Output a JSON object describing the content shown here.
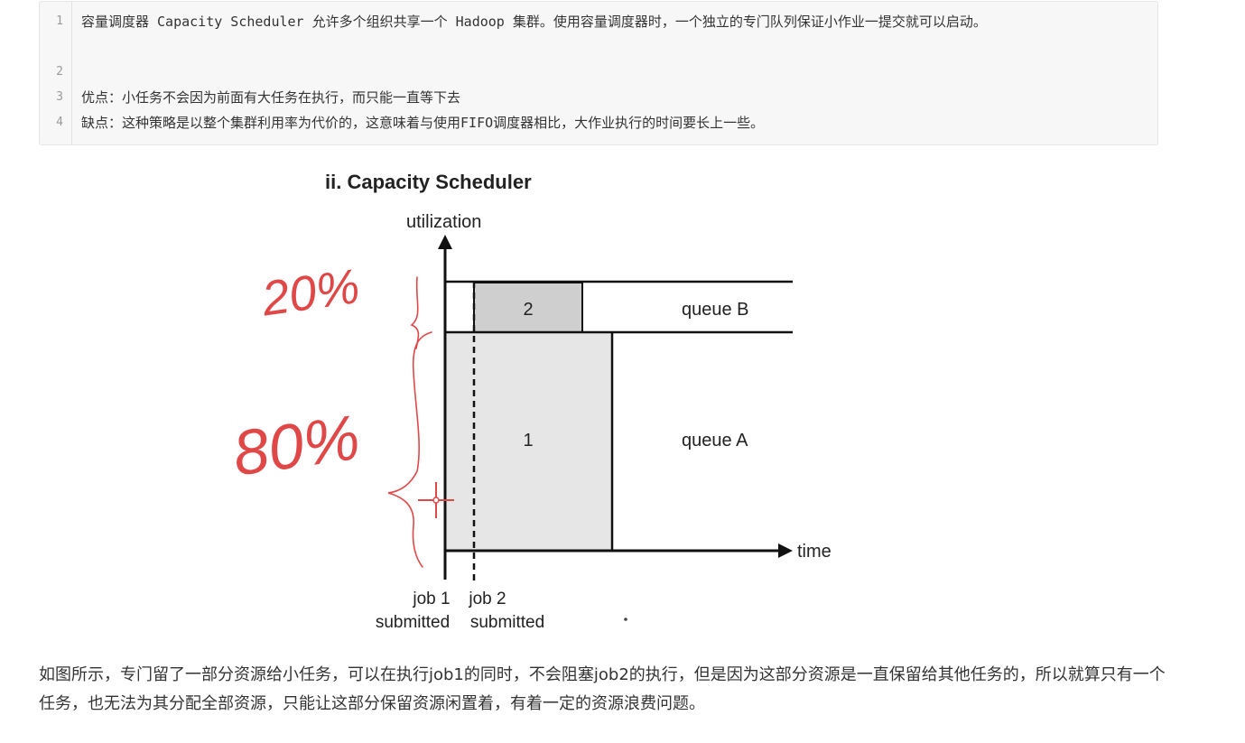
{
  "code_block": {
    "line_numbers": [
      "1",
      "2",
      "3",
      "4"
    ],
    "lines": [
      "容量调度器 Capacity Scheduler 允许多个组织共享一个 Hadoop 集群。使用容量调度器时，一个独立的专门队列保证小作业一提交就可以启动。",
      "",
      "优点：小任务不会因为前面有大任务在执行，而只能一直等下去",
      "缺点：这种策略是以整个集群利用率为代价的，这意味着与使用FIFO调度器相比，大作业执行的时间要长上一些。"
    ]
  },
  "figure": {
    "title": "ii. Capacity Scheduler",
    "y_axis_label": "utilization",
    "x_axis_label": "time",
    "job1_label": "1",
    "job2_label": "2",
    "queue_a_label": "queue A",
    "queue_b_label": "queue B",
    "job1_submitted_line1": "job 1",
    "job1_submitted_line2": "submitted",
    "job2_submitted_line1": "job 2",
    "job2_submitted_line2": "submitted",
    "annotation_queue_b_share": "20%",
    "annotation_queue_a_share": "80%",
    "annotation_color": "#e04848"
  },
  "paragraph": {
    "text": "如图所示，专门留了一部分资源给小任务，可以在执行job1的同时，不会阻塞job2的执行，但是因为这部分资源是一直保留给其他任务的，所以就算只有一个任务，也无法为其分配全部资源，只能让这部分保留资源闲置着，有着一定的资源浪费问题。"
  }
}
